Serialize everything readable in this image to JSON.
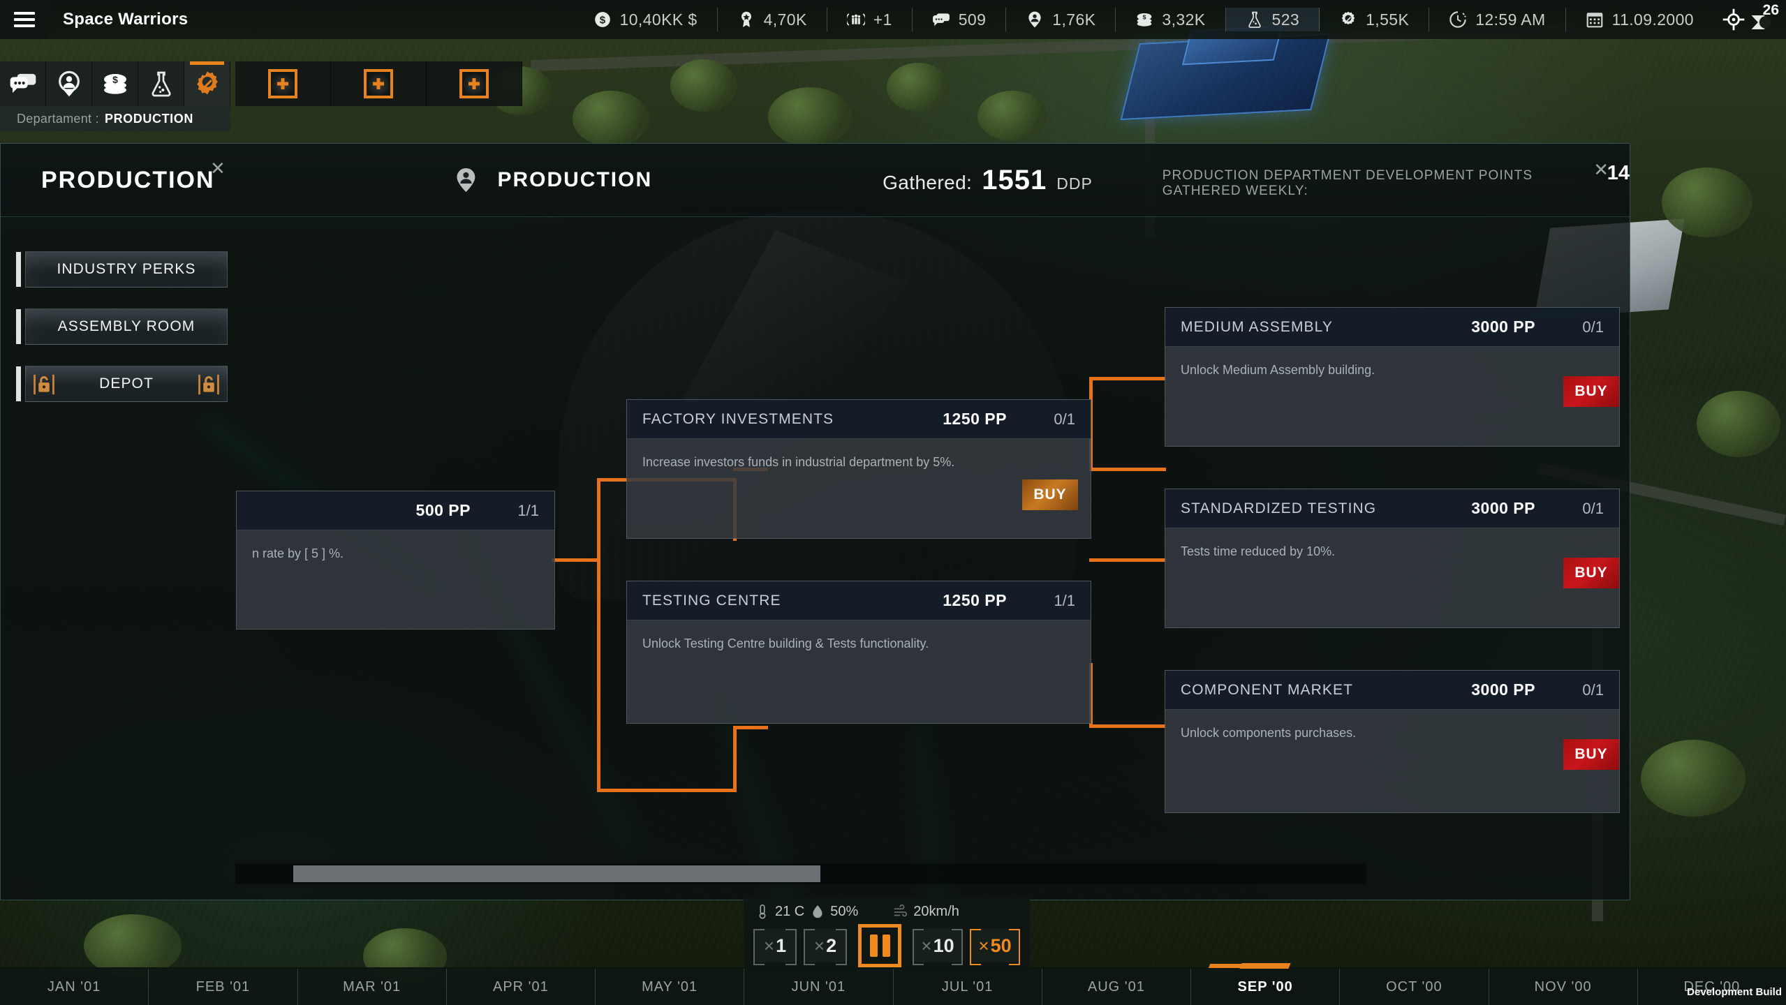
{
  "topbar": {
    "menu_icon": "hamburger-icon",
    "app_title": "Space Warriors",
    "resources": [
      {
        "icon": "dollar-coin-icon",
        "value": "10,40KK $"
      },
      {
        "icon": "medal-star-icon",
        "value": "4,70K"
      },
      {
        "icon": "population-icon",
        "value": "+1"
      },
      {
        "icon": "chat-bubbles-icon",
        "value": "509"
      },
      {
        "icon": "recruit-pin-icon",
        "value": "1,76K"
      },
      {
        "icon": "coin-stack-icon",
        "value": "3,32K"
      },
      {
        "icon": "flask-icon",
        "value": "523"
      },
      {
        "icon": "gear-hammer-icon",
        "value": "1,55K"
      }
    ],
    "clock": {
      "icon": "clock-icon",
      "value": "12:59 AM"
    },
    "calendar": {
      "icon": "calendar-icon",
      "value": "11.09.2000"
    },
    "crosshair_icon": "crosshair-target-icon",
    "mail": {
      "icon": "mail-icon",
      "count": "26"
    }
  },
  "department_tabs": {
    "items": [
      {
        "icon": "chat-bubbles-icon",
        "name": "communications",
        "active": false
      },
      {
        "icon": "recruit-pin-icon",
        "name": "recruitment",
        "active": false
      },
      {
        "icon": "coin-stack-icon",
        "name": "finance",
        "active": false
      },
      {
        "icon": "flask-icon",
        "name": "research",
        "active": false
      },
      {
        "icon": "gear-hammer-icon",
        "name": "production",
        "active": true
      }
    ],
    "department_label": "Departament :",
    "department_value": "PRODUCTION"
  },
  "build_slots": [
    {
      "icon": "plus-icon"
    },
    {
      "icon": "plus-icon"
    },
    {
      "icon": "plus-icon"
    }
  ],
  "panel": {
    "title": "PRODUCTION",
    "section_icon": "recruit-pin-icon",
    "section_title": "PRODUCTION",
    "gathered_label": "Gathered:",
    "gathered_value": "1551",
    "gathered_unit": "DDP",
    "weekly_label": "PRODUCTION DEPARTMENT DEVELOPMENT POINTS GATHERED WEEKLY:",
    "weekly_value": "14",
    "close_icon": "close-icon",
    "close_icon_2": "close-icon"
  },
  "left_nav": [
    {
      "label": "INDUSTRY PERKS",
      "locked": false
    },
    {
      "label": "ASSEMBLY ROOM",
      "locked": false
    },
    {
      "label": "DEPOT",
      "locked": true,
      "lock_icon": "lock-icon"
    }
  ],
  "cards": [
    {
      "name": "",
      "price": "500 PP",
      "level": "1/1",
      "desc": "n rate by [ 5 ] %.",
      "buy_label": "",
      "buy_state": "none"
    },
    {
      "name": "FACTORY INVESTMENTS",
      "price": "1250 PP",
      "level": "0/1",
      "desc": "Increase investors funds in industrial department by 5%.",
      "buy_label": "BUY",
      "buy_state": "orange"
    },
    {
      "name": "TESTING CENTRE",
      "price": "1250 PP",
      "level": "1/1",
      "desc": "Unlock Testing Centre building & Tests functionality.",
      "buy_label": "",
      "buy_state": "none"
    },
    {
      "name": "MEDIUM ASSEMBLY",
      "price": "3000 PP",
      "level": "0/1",
      "desc": "Unlock Medium Assembly building.",
      "buy_label": "BUY",
      "buy_state": "red"
    },
    {
      "name": "STANDARDIZED TESTING",
      "price": "3000 PP",
      "level": "0/1",
      "desc": "Tests time reduced by 10%.",
      "buy_label": "BUY",
      "buy_state": "red"
    },
    {
      "name": "COMPONENT MARKET",
      "price": "3000 PP",
      "level": "0/1",
      "desc": "Unlock components purchases.",
      "buy_label": "BUY",
      "buy_state": "red"
    }
  ],
  "weather": {
    "temp_icon": "thermometer-icon",
    "temp": "21 C",
    "humidity_icon": "water-drop-icon",
    "humidity": "50%",
    "wind_icon": "wind-icon",
    "wind": "20km/h"
  },
  "speed_controls": {
    "buttons": [
      {
        "label": "1",
        "selected": false
      },
      {
        "label": "2",
        "selected": false
      },
      {
        "label": "10",
        "selected": false
      },
      {
        "label": "50",
        "selected": true
      }
    ],
    "multiplier_symbol": "×",
    "pause_icon": "pause-icon",
    "pause_active": true
  },
  "timeline": {
    "months": [
      {
        "label": "JAN '01",
        "current": false
      },
      {
        "label": "FEB '01",
        "current": false
      },
      {
        "label": "MAR '01",
        "current": false
      },
      {
        "label": "APR '01",
        "current": false
      },
      {
        "label": "MAY '01",
        "current": false
      },
      {
        "label": "JUN '01",
        "current": false
      },
      {
        "label": "JUL '01",
        "current": false
      },
      {
        "label": "AUG '01",
        "current": false
      },
      {
        "label": "SEP '00",
        "current": true
      },
      {
        "label": "OCT '00",
        "current": false
      },
      {
        "label": "NOV '00",
        "current": false
      },
      {
        "label": "DEC '00",
        "current": false
      }
    ]
  },
  "watermark": "Development Build",
  "colors": {
    "accent_orange": "#e8821f",
    "buy_red": "#c8161b",
    "panel_bg": "#0a1010",
    "card_bg": "#343a40",
    "card_head": "#131c26"
  }
}
